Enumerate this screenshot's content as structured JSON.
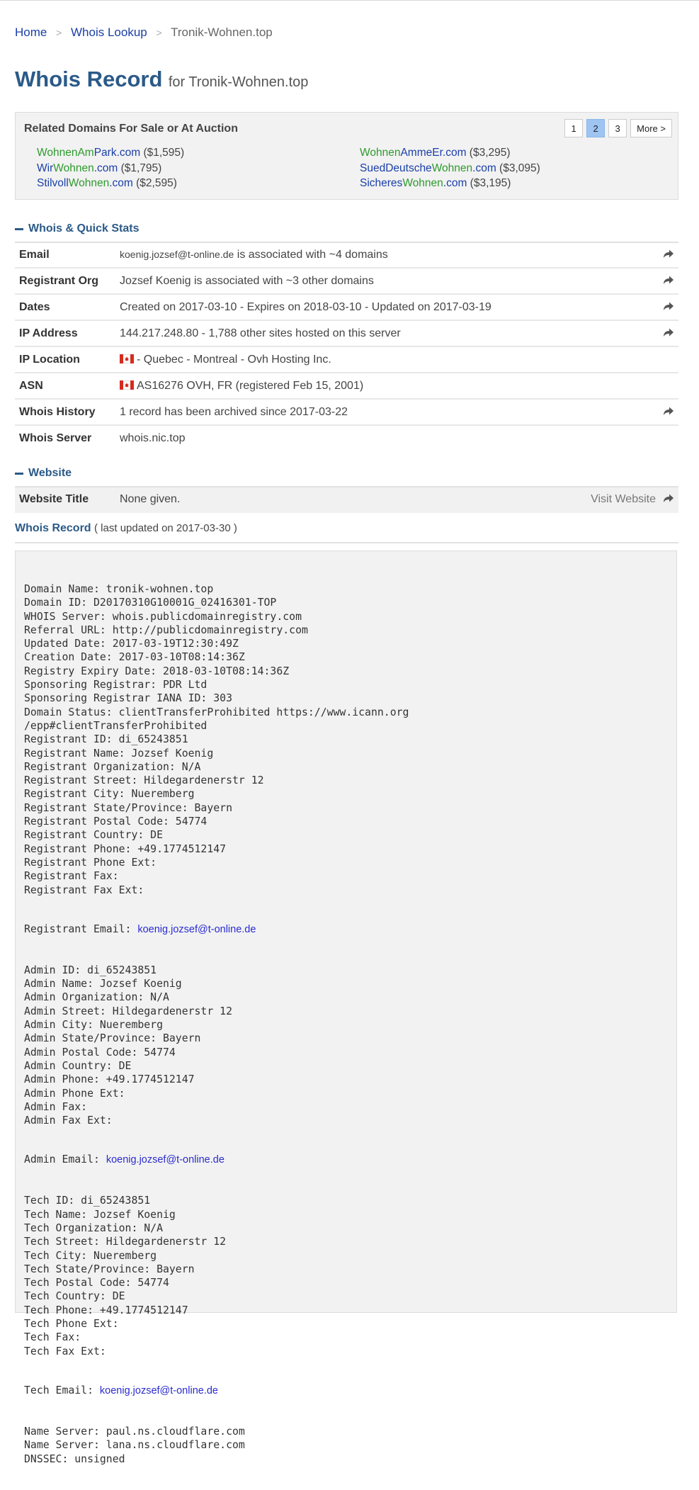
{
  "breadcrumb": {
    "home": "Home",
    "lookup": "Whois Lookup",
    "current": "Tronik-Wohnen.top",
    "separator": ">"
  },
  "page_title": {
    "main": "Whois Record",
    "sub": "for Tronik-Wohnen.top"
  },
  "related": {
    "heading": "Related Domains For Sale or At Auction",
    "pages": [
      "1",
      "2",
      "3"
    ],
    "active_page": "2",
    "more": "More >",
    "left": [
      {
        "a": "WohnenAm",
        "b": "Park",
        "c": ".com",
        "price": " ($1,595)"
      },
      {
        "a": "Wir",
        "b": "Wohnen",
        "c": ".com",
        "price": " ($1,795)"
      },
      {
        "a": "Stilvoll",
        "b": "Wohnen",
        "c": ".com",
        "price": " ($2,595)"
      }
    ],
    "right": [
      {
        "a": "Wohnen",
        "b": "AmmeEr",
        "c": ".com",
        "price": " ($3,295)"
      },
      {
        "a": "SuedDeutsche",
        "b": "Wohnen",
        "c": ".com",
        "price": " ($3,095)"
      },
      {
        "a": "Sicheres",
        "b": "Wohnen",
        "c": ".com",
        "price": " ($3,195)"
      }
    ]
  },
  "quick_stats": {
    "heading": "Whois & Quick Stats",
    "email_label": "Email",
    "email_value": "koenig.jozsef@t-online.de",
    "email_suffix": " is associated with ~4 domains",
    "org_label": "Registrant Org",
    "org_value": "Jozsef Koenig is associated with ~3 other domains",
    "dates_label": "Dates",
    "dates_value": "Created on 2017-03-10 - Expires on 2018-03-10 - Updated on 2017-03-19",
    "ip_label": "IP Address",
    "ip_value": "144.217.248.80 - 1,788 other sites hosted on this server",
    "iploc_label": "IP Location",
    "iploc_value": "- Quebec - Montreal - Ovh Hosting Inc.",
    "asn_label": "ASN",
    "asn_value": "AS16276 OVH, FR (registered Feb 15, 2001)",
    "history_label": "Whois History",
    "history_value": "1 record has been archived since 2017-03-22",
    "server_label": "Whois Server",
    "server_value": "whois.nic.top"
  },
  "website": {
    "heading": "Website",
    "title_label": "Website Title",
    "title_value": "None given.",
    "visit": "Visit Website"
  },
  "record": {
    "heading": "Whois Record",
    "updated": "( last updated on 2017-03-30 )",
    "lines_a": [
      "Domain Name: tronik-wohnen.top",
      "Domain ID: D20170310G10001G_02416301-TOP",
      "WHOIS Server: whois.publicdomainregistry.com",
      "Referral URL: http://publicdomainregistry.com",
      "Updated Date: 2017-03-19T12:30:49Z",
      "Creation Date: 2017-03-10T08:14:36Z",
      "Registry Expiry Date: 2018-03-10T08:14:36Z",
      "Sponsoring Registrar: PDR Ltd",
      "Sponsoring Registrar IANA ID: 303",
      "Domain Status: clientTransferProhibited https://www.icann.org",
      "/epp#clientTransferProhibited",
      "Registrant ID: di_65243851",
      "Registrant Name: Jozsef Koenig",
      "Registrant Organization: N/A",
      "Registrant Street: Hildegardenerstr 12",
      "Registrant City: Nueremberg",
      "Registrant State/Province: Bayern",
      "Registrant Postal Code: 54774",
      "Registrant Country: DE",
      "Registrant Phone: +49.1774512147",
      "Registrant Phone Ext:",
      "Registrant Fax:",
      "Registrant Fax Ext:"
    ],
    "registrant_email_label": "Registrant Email: ",
    "email": "koenig.jozsef@t-online.de",
    "lines_b": [
      "Admin ID: di_65243851",
      "Admin Name: Jozsef Koenig",
      "Admin Organization: N/A",
      "Admin Street: Hildegardenerstr 12",
      "Admin City: Nueremberg",
      "Admin State/Province: Bayern",
      "Admin Postal Code: 54774",
      "Admin Country: DE",
      "Admin Phone: +49.1774512147",
      "Admin Phone Ext:",
      "Admin Fax:",
      "Admin Fax Ext:"
    ],
    "admin_email_label": "Admin Email: ",
    "lines_c": [
      "Tech ID: di_65243851",
      "Tech Name: Jozsef Koenig",
      "Tech Organization: N/A",
      "Tech Street: Hildegardenerstr 12",
      "Tech City: Nueremberg",
      "Tech State/Province: Bayern",
      "Tech Postal Code: 54774",
      "Tech Country: DE",
      "Tech Phone: +49.1774512147",
      "Tech Phone Ext:",
      "Tech Fax:",
      "Tech Fax Ext:"
    ],
    "tech_email_label": "Tech Email: ",
    "lines_d": [
      "Name Server: paul.ns.cloudflare.com",
      "Name Server: lana.ns.cloudflare.com",
      "DNSSEC: unsigned"
    ]
  },
  "colors": {
    "accent": "#2b5a88",
    "link": "#1a3fa8",
    "green": "#2e9a2e",
    "active_page": "#9ec4f2"
  }
}
